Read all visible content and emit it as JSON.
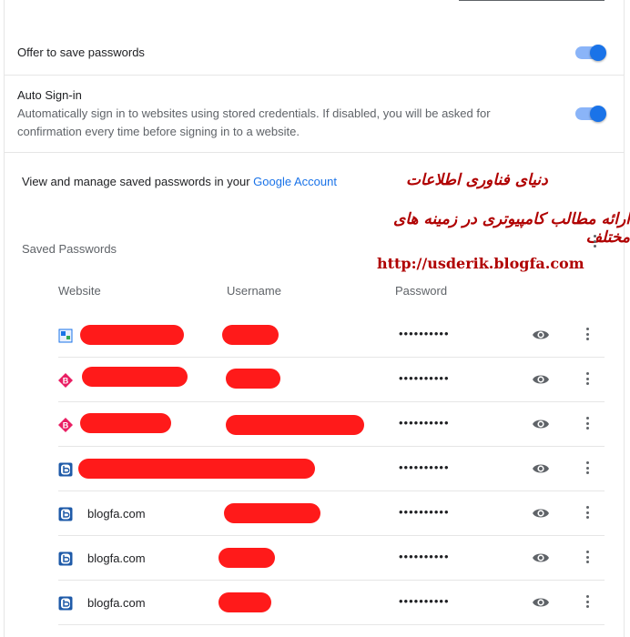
{
  "settings": {
    "offer_to_save": {
      "label": "Offer to save passwords",
      "enabled": true
    },
    "auto_signin": {
      "label": "Auto Sign-in",
      "description": "Automatically sign in to websites using stored credentials. If disabled, you will be asked for confirmation every time before signing in to a website.",
      "enabled": true
    },
    "manage_text": "View and manage saved passwords in your",
    "manage_link": "Google Account"
  },
  "saved_passwords": {
    "title": "Saved Passwords",
    "columns": {
      "website": "Website",
      "username": "Username",
      "password": "Password"
    },
    "rows": [
      {
        "site": "",
        "favicon": "generic-favicon-icon",
        "password": "••••••••••"
      },
      {
        "site": "",
        "favicon": "pink-b-favicon-icon",
        "password": "••••••••••"
      },
      {
        "site": "",
        "favicon": "pink-b-favicon-icon",
        "password": "••••••••••"
      },
      {
        "site": "",
        "favicon": "blogfa-favicon-icon",
        "password": "••••••••••"
      },
      {
        "site": "blogfa.com",
        "favicon": "blogfa-favicon-icon",
        "password": "••••••••••"
      },
      {
        "site": "blogfa.com",
        "favicon": "blogfa-favicon-icon",
        "password": "••••••••••"
      },
      {
        "site": "blogfa.com",
        "favicon": "blogfa-favicon-icon",
        "password": "••••••••••"
      }
    ]
  },
  "watermark": {
    "line1": "دنیای فناوری اطلاعات",
    "line2": "ارائه مطالب کامپیوتری در زمینه های مختلف",
    "url": "http://usderik.blogfa.com"
  },
  "colors": {
    "accent": "#1a73e8",
    "accent_light": "#8ab4f8",
    "redaction": "#ff1a1a",
    "watermark": "#b00000"
  }
}
